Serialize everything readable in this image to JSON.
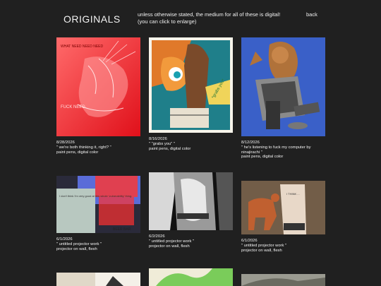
{
  "header": {
    "title": "ORIGINALS",
    "note_line1": "unless otherwise stated, the medium for all of these is digital!",
    "note_line2": "(you can click to enlarge)",
    "back_label": "back"
  },
  "artworks": [
    {
      "date": "8/28/2026",
      "title": "\" we're both thinking it, right? \"",
      "medium": "paint pens, digital color",
      "extra": ""
    },
    {
      "date": "8/16/2026",
      "title": "\" \"grabs you\" \"",
      "medium": "paint pens, digital color",
      "extra": ""
    },
    {
      "date": "8/12/2026",
      "title": "\" he's listening to fuck my computer by",
      "medium": "ninajirachi \"",
      "extra": "paint pens, digital color"
    },
    {
      "date": "6/1/2026",
      "title": "\" untitled projector work \"",
      "medium": "projector on wall, flesh",
      "extra": ""
    },
    {
      "date": "6/2/2026",
      "title": "\" untitled projector work \"",
      "medium": "projector on wall, flesh",
      "extra": ""
    },
    {
      "date": "6/1/2026",
      "title": "\" untitled projector work \"",
      "medium": "projector on wall, flesh",
      "extra": ""
    }
  ],
  "artwork_text": {
    "red_left": "WHAT NEED NEED NEED",
    "red_lower": "FUCK NEED",
    "fox_speech": "*grabs you*",
    "proj1_text": "I don't think I'm very good at this whole 'vulnerability' thing.",
    "proj1_sign": "BEER BAR",
    "proj3_text": "I THINK ..."
  },
  "colors": {
    "background": "#202020",
    "text": "#f2f2f2"
  }
}
